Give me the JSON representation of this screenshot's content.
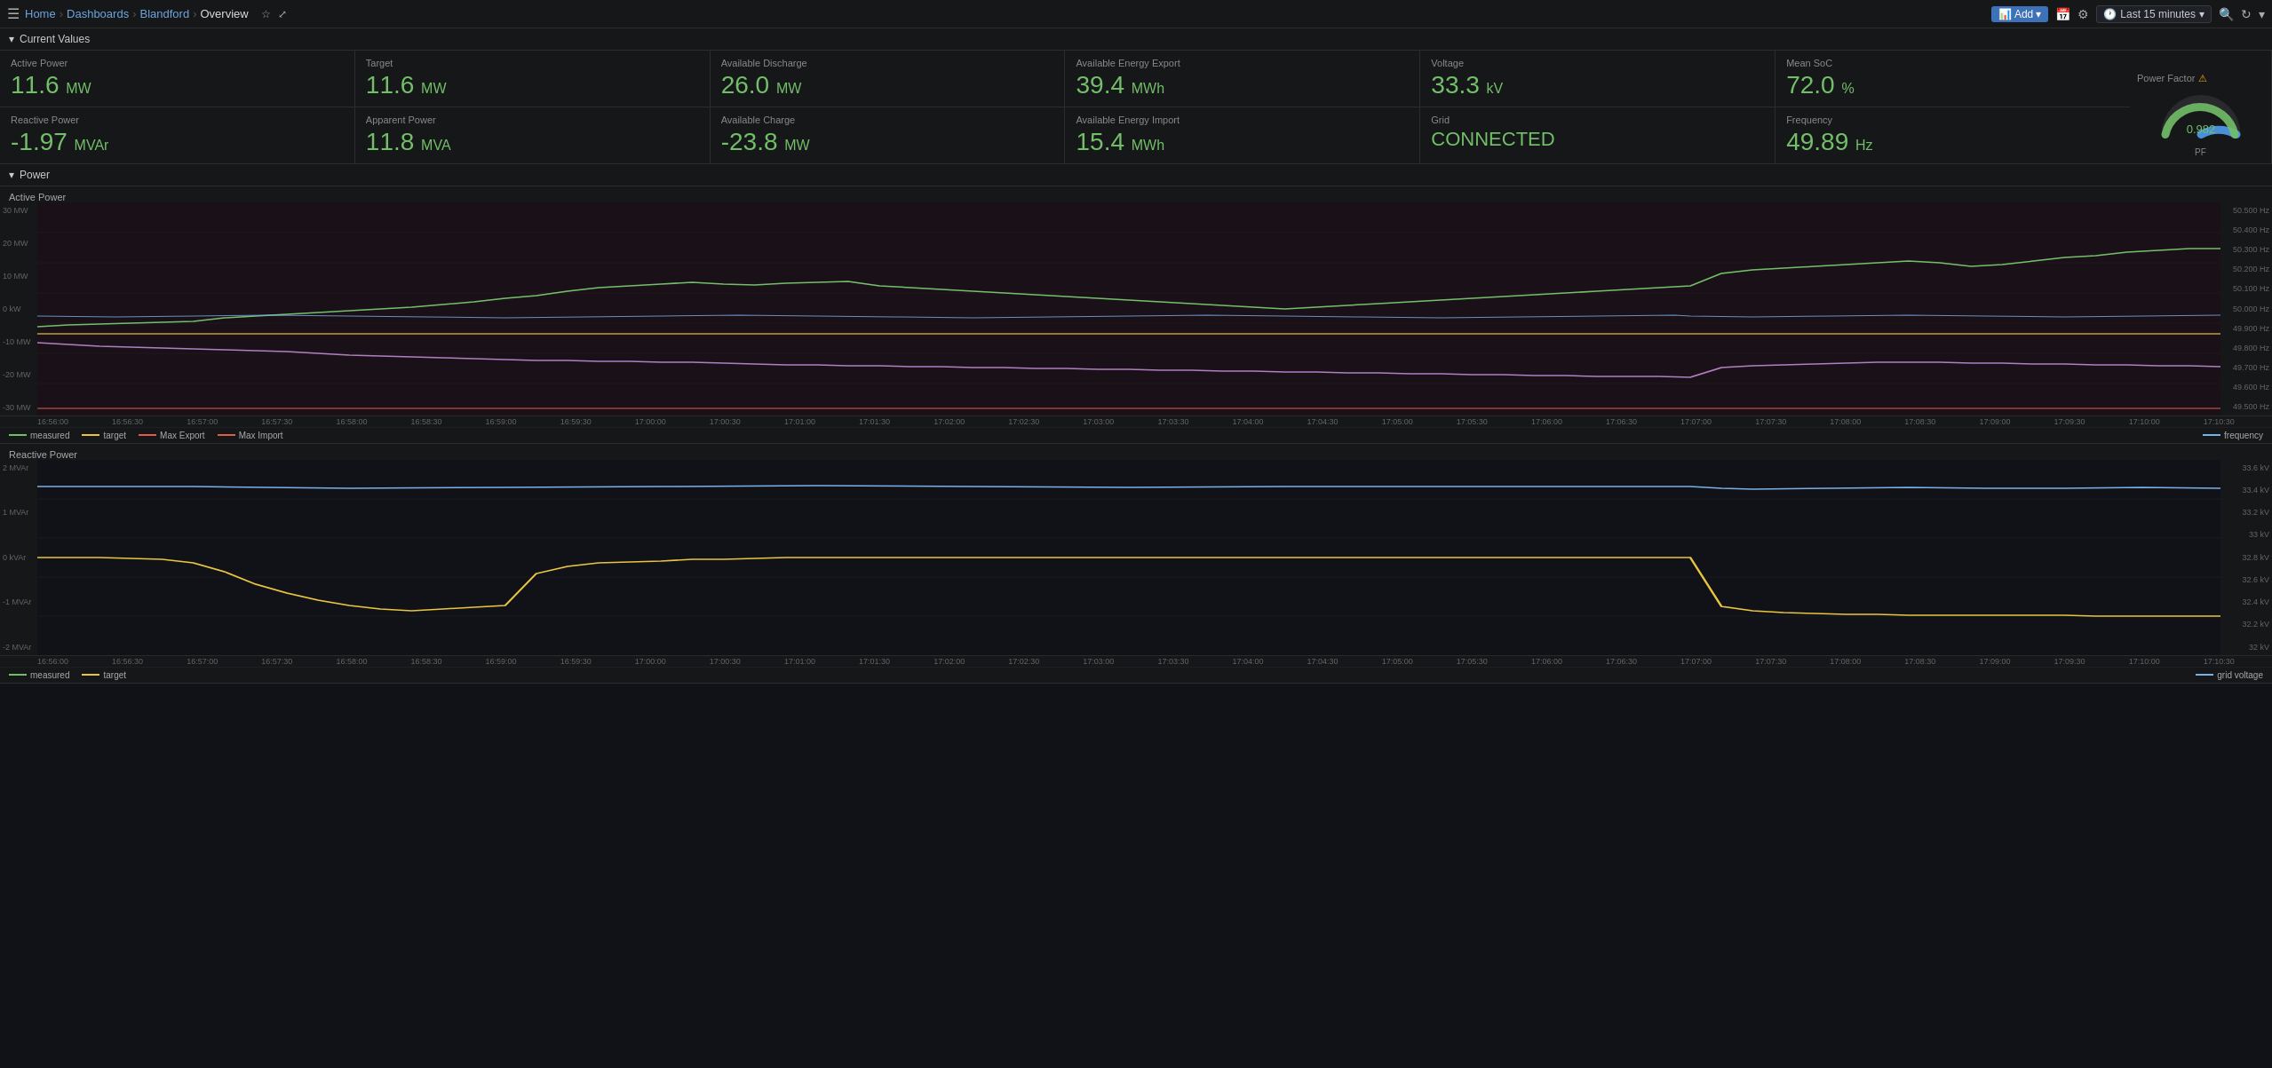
{
  "nav": {
    "home": "Home",
    "dashboards": "Dashboards",
    "blandford": "Blandford",
    "overview": "Overview",
    "add_label": "Add",
    "time_range": "Last 15 minutes"
  },
  "sections": {
    "current_values": "Current Values",
    "power": "Power"
  },
  "metrics_row1": [
    {
      "id": "active-power",
      "label": "Active Power",
      "value": "11.6",
      "unit": "MW"
    },
    {
      "id": "target",
      "label": "Target",
      "value": "11.6",
      "unit": "MW"
    },
    {
      "id": "available-discharge",
      "label": "Available Discharge",
      "value": "26.0",
      "unit": "MW"
    },
    {
      "id": "available-energy-export",
      "label": "Available Energy Export",
      "value": "39.4",
      "unit": "MWh"
    },
    {
      "id": "voltage",
      "label": "Voltage",
      "value": "33.3",
      "unit": "kV"
    },
    {
      "id": "mean-soc",
      "label": "Mean SoC",
      "value": "72.0",
      "unit": "%"
    }
  ],
  "metrics_row2": [
    {
      "id": "reactive-power",
      "label": "Reactive Power",
      "value": "-1.97",
      "unit": "MVAr"
    },
    {
      "id": "apparent-power",
      "label": "Apparent Power",
      "value": "11.8",
      "unit": "MVA"
    },
    {
      "id": "available-charge",
      "label": "Available Charge",
      "value": "-23.8",
      "unit": "MW"
    },
    {
      "id": "available-energy-import",
      "label": "Available Energy Import",
      "value": "15.4",
      "unit": "MWh"
    },
    {
      "id": "grid",
      "label": "Grid",
      "value": "CONNECTED",
      "unit": ""
    },
    {
      "id": "frequency",
      "label": "Frequency",
      "value": "49.89",
      "unit": "Hz"
    }
  ],
  "power_factor": {
    "label": "Power Factor",
    "value": "0.982",
    "unit": "PF"
  },
  "active_power_chart": {
    "title": "Active Power",
    "y_left": [
      "30 MW",
      "20 MW",
      "10 MW",
      "0 kW",
      "-10 MW",
      "-20 MW",
      "-30 MW"
    ],
    "y_right": [
      "50.500 Hz",
      "50.400 Hz",
      "50.300 Hz",
      "50.200 Hz",
      "50.100 Hz",
      "50.000 Hz",
      "49.900 Hz",
      "49.800 Hz",
      "49.700 Hz",
      "49.600 Hz",
      "49.500 Hz"
    ],
    "x_axis": [
      "16:56:00",
      "16:56:30",
      "16:57:00",
      "16:57:30",
      "16:58:00",
      "16:58:30",
      "16:59:00",
      "16:59:30",
      "17:00:00",
      "17:00:30",
      "17:01:00",
      "17:01:30",
      "17:02:00",
      "17:02:30",
      "17:03:00",
      "17:03:30",
      "17:04:00",
      "17:04:30",
      "17:05:00",
      "17:05:30",
      "17:06:00",
      "17:06:30",
      "17:07:00",
      "17:07:30",
      "17:08:00",
      "17:08:30",
      "17:09:00",
      "17:09:30",
      "17:10:00",
      "17:10:30"
    ],
    "legend": [
      {
        "label": "measured",
        "color": "#73bf69"
      },
      {
        "label": "target",
        "color": "#e8c441"
      },
      {
        "label": "Max Export",
        "color": "#e05c4a"
      },
      {
        "label": "Max Import",
        "color": "#e05c4a"
      }
    ],
    "legend_right": {
      "label": "frequency",
      "color": "#7ab0e8"
    }
  },
  "reactive_power_chart": {
    "title": "Reactive Power",
    "y_left": [
      "2 MVAr",
      "1 MVAr",
      "0 kVAr",
      "-1 MVAr",
      "-2 MVAr"
    ],
    "y_right": [
      "33.6 kV",
      "33.4 kV",
      "33.2 kV",
      "33 kV",
      "32.8 kV",
      "32.6 kV",
      "32.4 kV",
      "32.2 kV",
      "32 kV"
    ],
    "x_axis": [
      "16:56:00",
      "16:56:30",
      "16:57:00",
      "16:57:30",
      "16:58:00",
      "16:58:30",
      "16:59:00",
      "16:59:30",
      "17:00:00",
      "17:00:30",
      "17:01:00",
      "17:01:30",
      "17:02:00",
      "17:02:30",
      "17:03:00",
      "17:03:30",
      "17:04:00",
      "17:04:30",
      "17:05:00",
      "17:05:30",
      "17:06:00",
      "17:06:30",
      "17:07:00",
      "17:07:30",
      "17:08:00",
      "17:08:30",
      "17:09:00",
      "17:09:30",
      "17:10:00",
      "17:10:30"
    ],
    "legend": [
      {
        "label": "measured",
        "color": "#73bf69"
      },
      {
        "label": "target",
        "color": "#e8c441"
      }
    ],
    "legend_right": {
      "label": "grid voltage",
      "color": "#7ab0e8"
    }
  }
}
